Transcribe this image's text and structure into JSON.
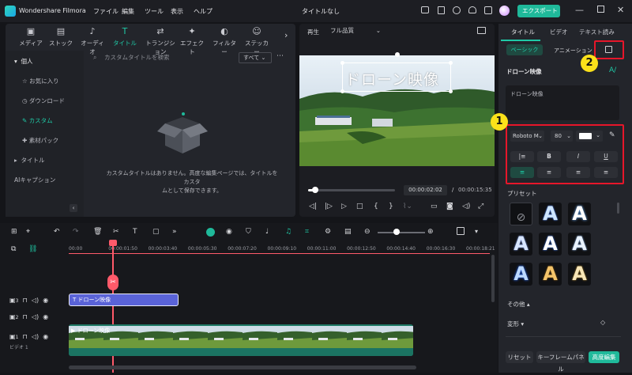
{
  "app": {
    "name": "Wondershare Filmora",
    "menu": [
      "ファイル",
      "編集",
      "ツール",
      "表示",
      "ヘルプ"
    ],
    "project_title": "タイトルなし",
    "export_label": "エクスポート"
  },
  "media_tabs": [
    {
      "label": "メディア",
      "icon": "media-icon"
    },
    {
      "label": "ストック",
      "icon": "stock-icon"
    },
    {
      "label": "オーディオ",
      "icon": "audio-icon"
    },
    {
      "label": "タイトル",
      "icon": "title-icon"
    },
    {
      "label": "トランジション",
      "icon": "transition-icon"
    },
    {
      "label": "エフェクト",
      "icon": "effect-icon"
    },
    {
      "label": "フィルター",
      "icon": "filter-icon"
    },
    {
      "label": "ステッカー",
      "icon": "sticker-icon"
    }
  ],
  "sidebar": {
    "section": "個人",
    "items": [
      "お気に入り",
      "ダウンロード",
      "カスタム",
      "素材パック"
    ],
    "title_label": "タイトル",
    "ai_caption": "AIキャプション"
  },
  "library": {
    "search_placeholder": "カスタムタイトルを検索",
    "filter_label": "すべて",
    "empty_message_line1": "カスタムタイトルはありません。高度な編集ページでは、タイトルをカスタ",
    "empty_message_line2": "ムとして保存できます。"
  },
  "player": {
    "play_label": "再生",
    "quality_label": "フル品質",
    "overlay_text": "ドローン映像",
    "current_time": "00:00:02:02",
    "separator": "/",
    "total_time": "00:00:15:35",
    "progress": 0.08
  },
  "right_panel": {
    "tabs": [
      "タイトル",
      "ビデオ",
      "テキスト読み"
    ],
    "subtabs": [
      "ベーシック",
      "アニメーション"
    ],
    "text_label": "ドローン映像",
    "text_value": "ドローン映像",
    "font_name": "Roboto M",
    "font_size": "80",
    "text_color": "#ffffff",
    "bold_label": "B",
    "italic_label": "I",
    "underline_label": "U",
    "preset_label": "プリセット",
    "other_label": "その他",
    "transform_label": "変形",
    "reset_label": "リセット",
    "keyframe_label": "キーフレームパネル",
    "advanced_label": "高度編集",
    "preset_glyph": "A"
  },
  "callouts": [
    "1",
    "2"
  ],
  "timeline": {
    "ticks": [
      "00:00",
      "00:00:01:50",
      "00:00:03:40",
      "00:00:05:30",
      "00:00:07:20",
      "00:00:09:10",
      "00:00:11:00",
      "00:00:12:50",
      "00:00:14:40",
      "00:00:16:30",
      "00:00:18:21"
    ],
    "title_clip": "ドローン映像",
    "video_clip": "ドローン映像",
    "track_numbers": [
      "3",
      "2",
      "1"
    ],
    "video_track_label": "ビデオ 1",
    "zoom": 0.4
  },
  "colors": {
    "accent": "#1fb99a",
    "highlight": "#e6162a",
    "callout": "#fbe11a",
    "playhead": "#ff5a6a"
  }
}
